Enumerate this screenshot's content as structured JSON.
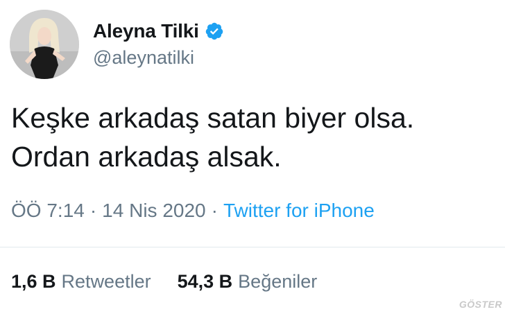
{
  "author": {
    "display_name": "Aleyna Tilki",
    "handle": "@aleynatilki",
    "verified": true,
    "avatar_icon": "profile-photo"
  },
  "tweet": {
    "text": "Keşke arkadaş satan biyer olsa.\nOrdan arkadaş alsak.",
    "time": "ÖÖ 7:14",
    "date": "14 Nis 2020",
    "separator": "·",
    "source": "Twitter for iPhone"
  },
  "stats": {
    "retweets_count": "1,6 B",
    "retweets_label": "Retweetler",
    "likes_count": "54,3 B",
    "likes_label": "Beğeniler"
  },
  "watermark": {
    "text": "GÖSTER"
  },
  "colors": {
    "verified_badge": "#1da1f2",
    "link": "#1da1f2",
    "secondary_text": "#657786",
    "primary_text": "#14171a"
  }
}
